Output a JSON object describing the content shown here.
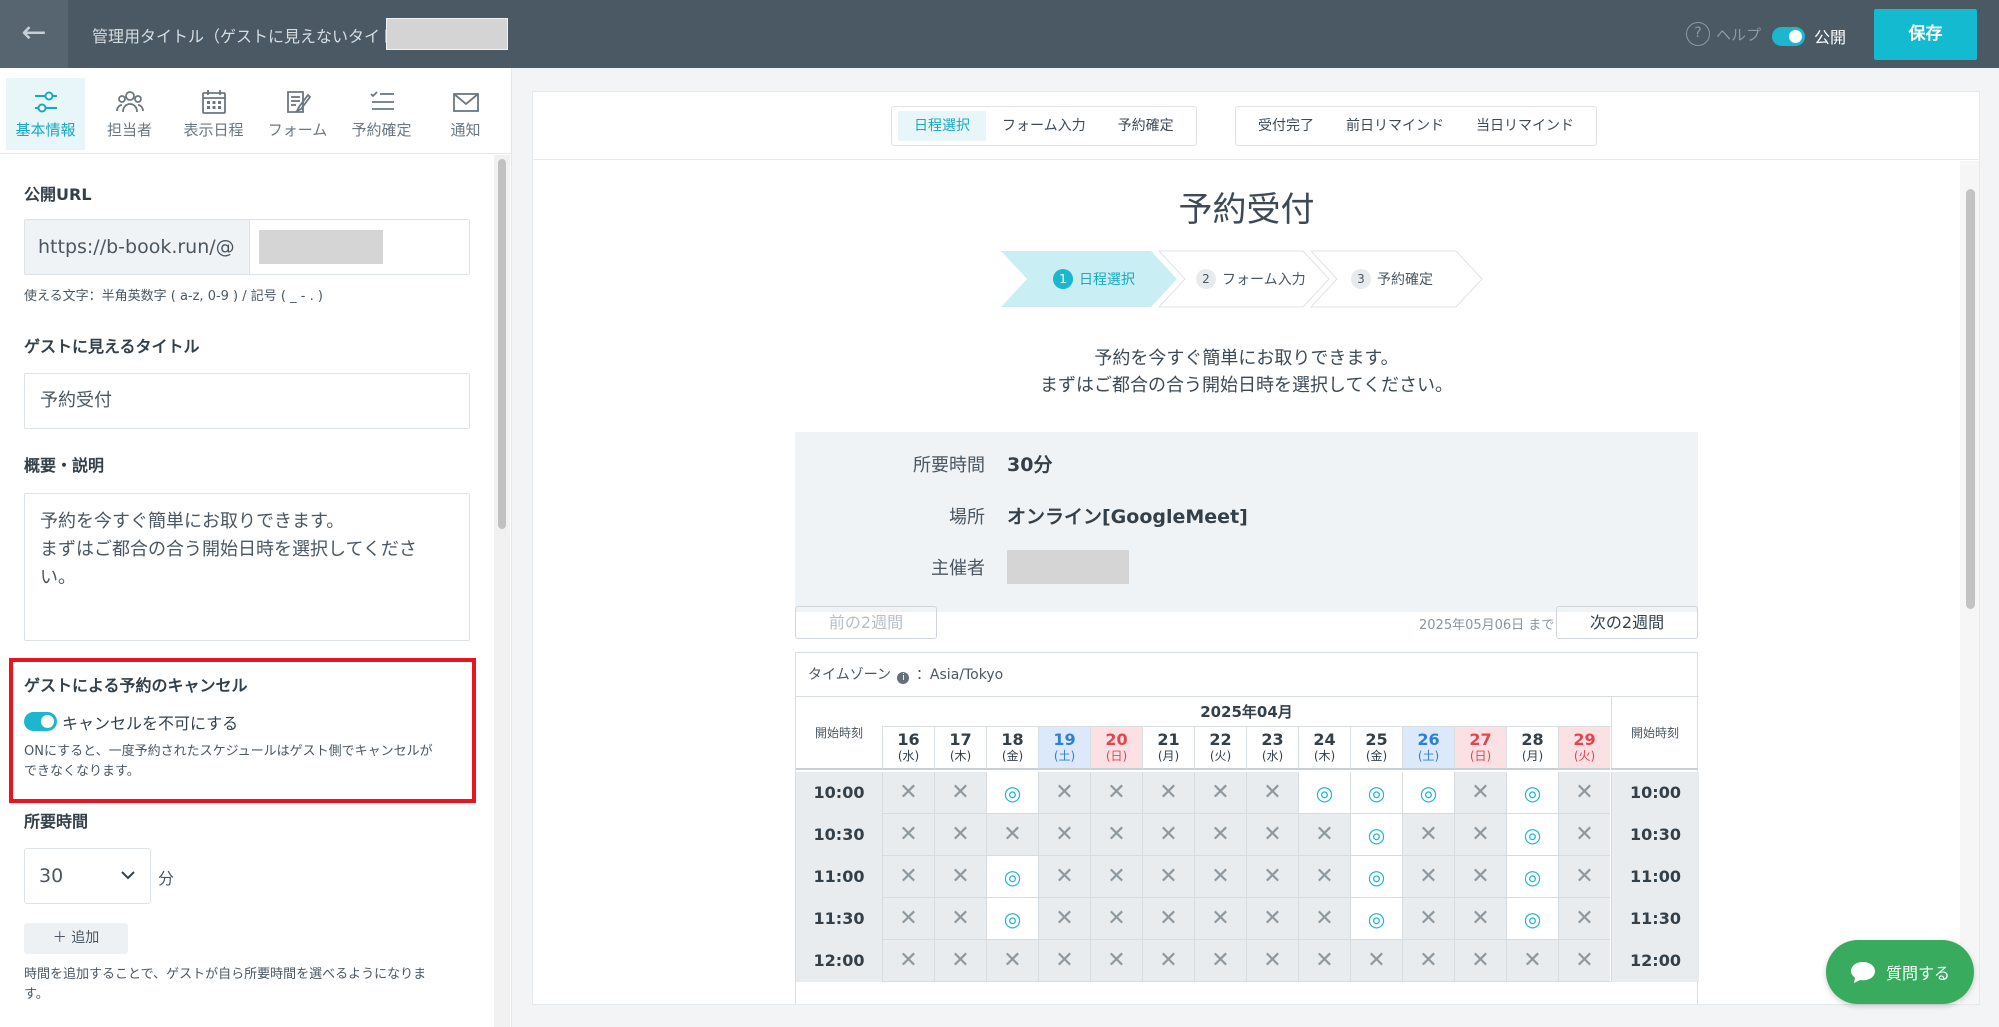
{
  "topbar": {
    "back_label": "←",
    "admin_title": "管理用タイトル（ゲストに見えないタイトル）",
    "help_label": "ヘルプ",
    "public_label": "公開",
    "save_label": "保存"
  },
  "tabs": [
    {
      "label": "基本情報",
      "icon": "sliders-icon"
    },
    {
      "label": "担当者",
      "icon": "people-icon"
    },
    {
      "label": "表示日程",
      "icon": "calendar-icon"
    },
    {
      "label": "フォーム",
      "icon": "form-icon"
    },
    {
      "label": "予約確定",
      "icon": "checklist-icon"
    },
    {
      "label": "通知",
      "icon": "mail-icon"
    }
  ],
  "form": {
    "url_label": "公開URL",
    "url_prefix": "https://b-book.run/@",
    "url_hint": "使える文字：半角英数字 ( a-z, 0-9 ) / 記号 ( _ - . )",
    "title_label": "ゲストに見えるタイトル",
    "title_value": "予約受付",
    "desc_label": "概要・説明",
    "desc_line1": "予約を今すぐ簡単にお取りできます。",
    "desc_line2": "まずはご都合の合う開始日時を選択してくださ",
    "desc_line3": "い。",
    "cancel_label": "ゲストによる予約のキャンセル",
    "cancel_toggle_label": "キャンセルを不可にする",
    "cancel_hint1": "ONにすると、一度予約されたスケジュールはゲスト側でキャンセルが",
    "cancel_hint2": "できなくなります。",
    "duration_label": "所要時間",
    "duration_value": "30",
    "duration_unit": "分",
    "add_label": "＋ 追加",
    "duration_hint1": "時間を追加することで、ゲストが自ら所要時間を選べるようになりま",
    "duration_hint2": "す。"
  },
  "preview": {
    "seg1": [
      "日程選択",
      "フォーム入力",
      "予約確定"
    ],
    "seg2": [
      "受付完了",
      "前日リマインド",
      "当日リマインド"
    ],
    "title": "予約受付",
    "steps": [
      {
        "num": "1",
        "label": "日程選択"
      },
      {
        "num": "2",
        "label": "フォーム入力"
      },
      {
        "num": "3",
        "label": "予約確定"
      }
    ],
    "desc1": "予約を今すぐ簡単にお取りできます。",
    "desc2": "まずはご都合の合う開始日時を選択してください。",
    "duration_key": "所要時間",
    "duration_val": "30分",
    "place_key": "場所",
    "place_val": "オンライン[GoogleMeet]",
    "host_key": "主催者",
    "prev_label": "前の2週間",
    "until_label": "2025年05月06日 まで",
    "next_label": "次の2週間",
    "timezone_label": "タイムゾーン",
    "timezone_value": "：Asia/Tokyo",
    "month": "2025年04月",
    "start_time_label": "開始時刻",
    "days": [
      {
        "d": "16",
        "w": "(水)",
        "t": "wd"
      },
      {
        "d": "17",
        "w": "(木)",
        "t": "wd"
      },
      {
        "d": "18",
        "w": "(金)",
        "t": "wd"
      },
      {
        "d": "19",
        "w": "(土)",
        "t": "sat"
      },
      {
        "d": "20",
        "w": "(日)",
        "t": "sun"
      },
      {
        "d": "21",
        "w": "(月)",
        "t": "wd"
      },
      {
        "d": "22",
        "w": "(火)",
        "t": "wd"
      },
      {
        "d": "23",
        "w": "(水)",
        "t": "wd"
      },
      {
        "d": "24",
        "w": "(木)",
        "t": "wd"
      },
      {
        "d": "25",
        "w": "(金)",
        "t": "wd"
      },
      {
        "d": "26",
        "w": "(土)",
        "t": "sat"
      },
      {
        "d": "27",
        "w": "(日)",
        "t": "sun"
      },
      {
        "d": "28",
        "w": "(月)",
        "t": "wd"
      },
      {
        "d": "29",
        "w": "(火)",
        "t": "sun"
      }
    ],
    "rows": [
      {
        "time": "10:00",
        "slots": "xxoxxxxxoooxox"
      },
      {
        "time": "10:30",
        "slots": "xxxxxxxxxoxxox"
      },
      {
        "time": "11:00",
        "slots": "xxoxxxxxxoxxox"
      },
      {
        "time": "11:30",
        "slots": "xxoxxxxxxoxxox"
      },
      {
        "time": "12:00",
        "slots": "xxxxxxxxxxxxxx"
      }
    ],
    "available_symbol": "◎",
    "unavailable_symbol": "✕"
  },
  "chat_label": "質問する",
  "colors": {
    "accent": "#1cb6cf",
    "topbar": "#4a5964",
    "highlight": "#e8141f",
    "chat": "#38ab5e",
    "saturday": "#2f7fd8",
    "sunday": "#e5444e"
  }
}
